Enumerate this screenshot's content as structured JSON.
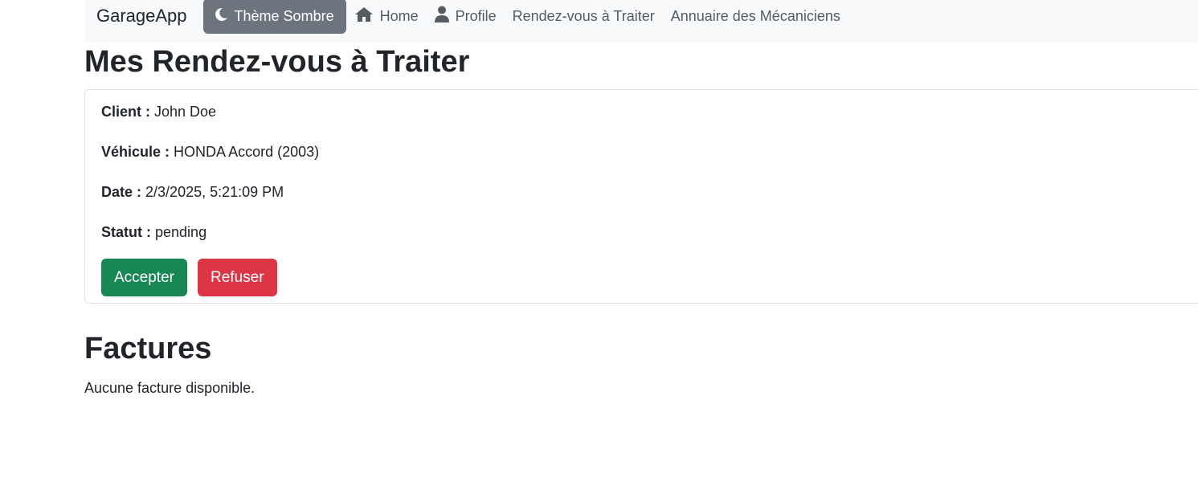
{
  "navbar": {
    "brand": "GarageApp",
    "theme_button": "Thème Sombre",
    "links": [
      {
        "label": "Home",
        "icon": "home-icon"
      },
      {
        "label": "Profile",
        "icon": "user-icon"
      },
      {
        "label": "Rendez-vous à Traiter"
      },
      {
        "label": "Annuaire des Mécaniciens"
      }
    ]
  },
  "page": {
    "title": "Mes Rendez-vous à Traiter"
  },
  "appointment": {
    "client_label": "Client :",
    "client_value": "John Doe",
    "vehicle_label": "Véhicule :",
    "vehicle_value": "HONDA Accord (2003)",
    "date_label": "Date :",
    "date_value": "2/3/2025, 5:21:09 PM",
    "status_label": "Statut :",
    "status_value": "pending",
    "accept_label": "Accepter",
    "refuse_label": "Refuser"
  },
  "invoices": {
    "title": "Factures",
    "empty_text": "Aucune facture disponible."
  },
  "colors": {
    "navbar_bg": "#f8f9fa",
    "theme_button_bg": "#6c757d",
    "accept_bg": "#198754",
    "refuse_bg": "#dc3545"
  }
}
